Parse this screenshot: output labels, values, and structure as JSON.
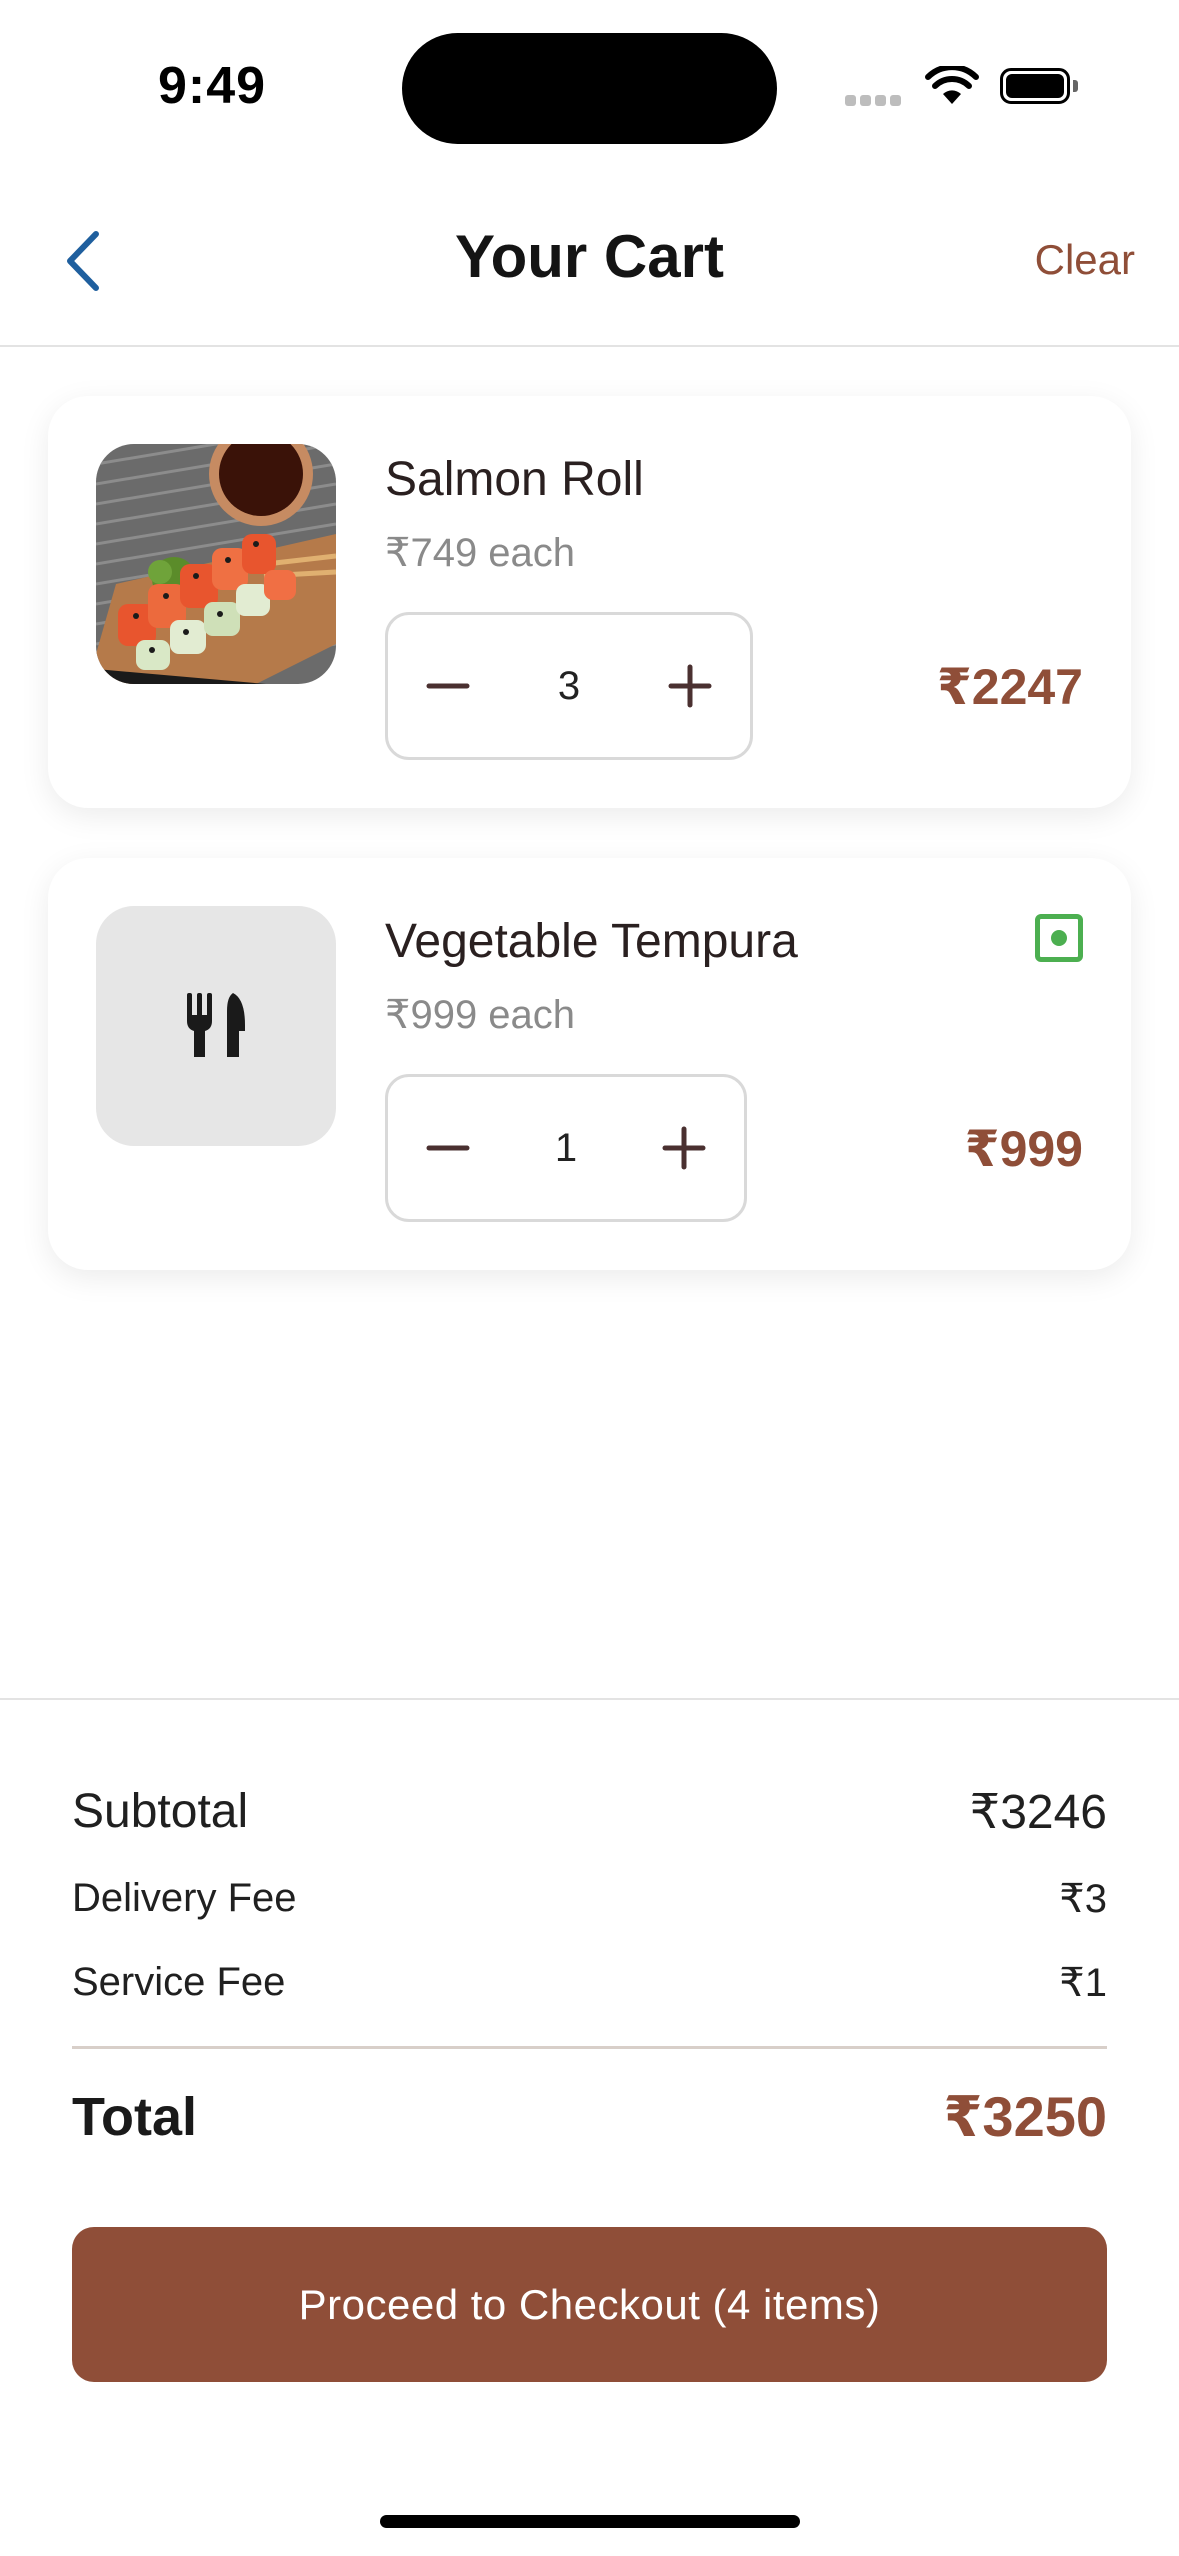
{
  "status_bar": {
    "time": "9:49"
  },
  "header": {
    "title": "Your Cart",
    "clear_label": "Clear"
  },
  "cart": {
    "items": [
      {
        "name": "Salmon Roll",
        "unit_price": "₹749 each",
        "quantity": "3",
        "line_total": "₹2247",
        "image": "salmon-roll-photo",
        "veg": false
      },
      {
        "name": "Vegetable Tempura",
        "unit_price": "₹999 each",
        "quantity": "1",
        "line_total": "₹999",
        "image": "utensils-placeholder-icon",
        "veg": true
      }
    ]
  },
  "summary": {
    "subtotal_label": "Subtotal",
    "subtotal_value": "₹3246",
    "delivery_label": "Delivery Fee",
    "delivery_value": "₹3",
    "service_label": "Service Fee",
    "service_value": "₹1",
    "total_label": "Total",
    "total_value": "₹3250"
  },
  "checkout": {
    "label": "Proceed to Checkout (4 items)"
  },
  "colors": {
    "accent": "#8f4e38",
    "back_arrow": "#1f5f9e",
    "veg_green": "#4caf50"
  }
}
